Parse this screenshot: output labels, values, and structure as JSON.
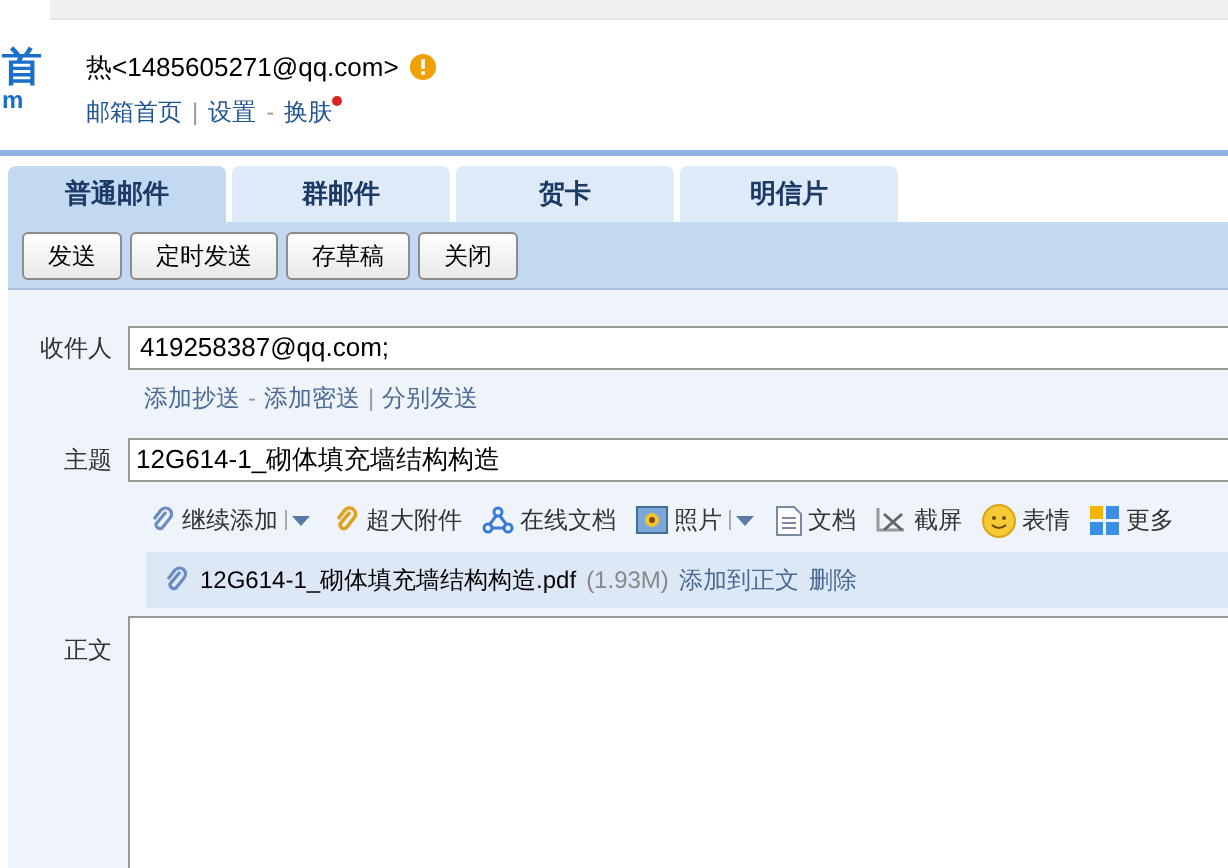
{
  "logo": {
    "line_1": "首",
    "line_2": "m"
  },
  "account": {
    "name": "热<1485605271@qq.com>",
    "warning": true,
    "links": [
      "邮箱首页",
      "设置",
      "换肤"
    ],
    "separators": [
      "|",
      "-"
    ],
    "skin_new": true
  },
  "tabs": [
    {
      "label": "普通邮件",
      "selected": true
    },
    {
      "label": "群邮件",
      "selected": false
    },
    {
      "label": "贺卡",
      "selected": false
    },
    {
      "label": "明信片",
      "selected": false
    }
  ],
  "buttons": [
    "发送",
    "定时发送",
    "存草稿",
    "关闭"
  ],
  "to": {
    "label": "收件人",
    "value": "419258387@qq.com;"
  },
  "recipient_links": [
    "添加抄送",
    "添加密送",
    "分别发送"
  ],
  "recipient_separators": [
    "-",
    "|"
  ],
  "subject": {
    "label": "主题",
    "value": "12G614-1_砌体填充墙结构构造"
  },
  "tools": [
    {
      "kind": "attach",
      "label": "继续添加",
      "menu": true
    },
    {
      "kind": "bigattach",
      "label": "超大附件",
      "menu": false
    },
    {
      "kind": "online",
      "label": "在线文档",
      "menu": false
    },
    {
      "kind": "photo",
      "label": "照片",
      "menu": true
    },
    {
      "kind": "doc",
      "label": "文档",
      "menu": false
    },
    {
      "kind": "screenshot",
      "label": "截屏",
      "menu": false
    },
    {
      "kind": "emoji",
      "label": "表情",
      "menu": false
    },
    {
      "kind": "more",
      "label": "更多",
      "menu": false
    }
  ],
  "attachment": {
    "name": "12G614-1_砌体填充墙结构构造.pdf",
    "size": "(1.93M)",
    "actions": [
      "添加到正文",
      "删除"
    ]
  },
  "body": {
    "label": "正文"
  }
}
